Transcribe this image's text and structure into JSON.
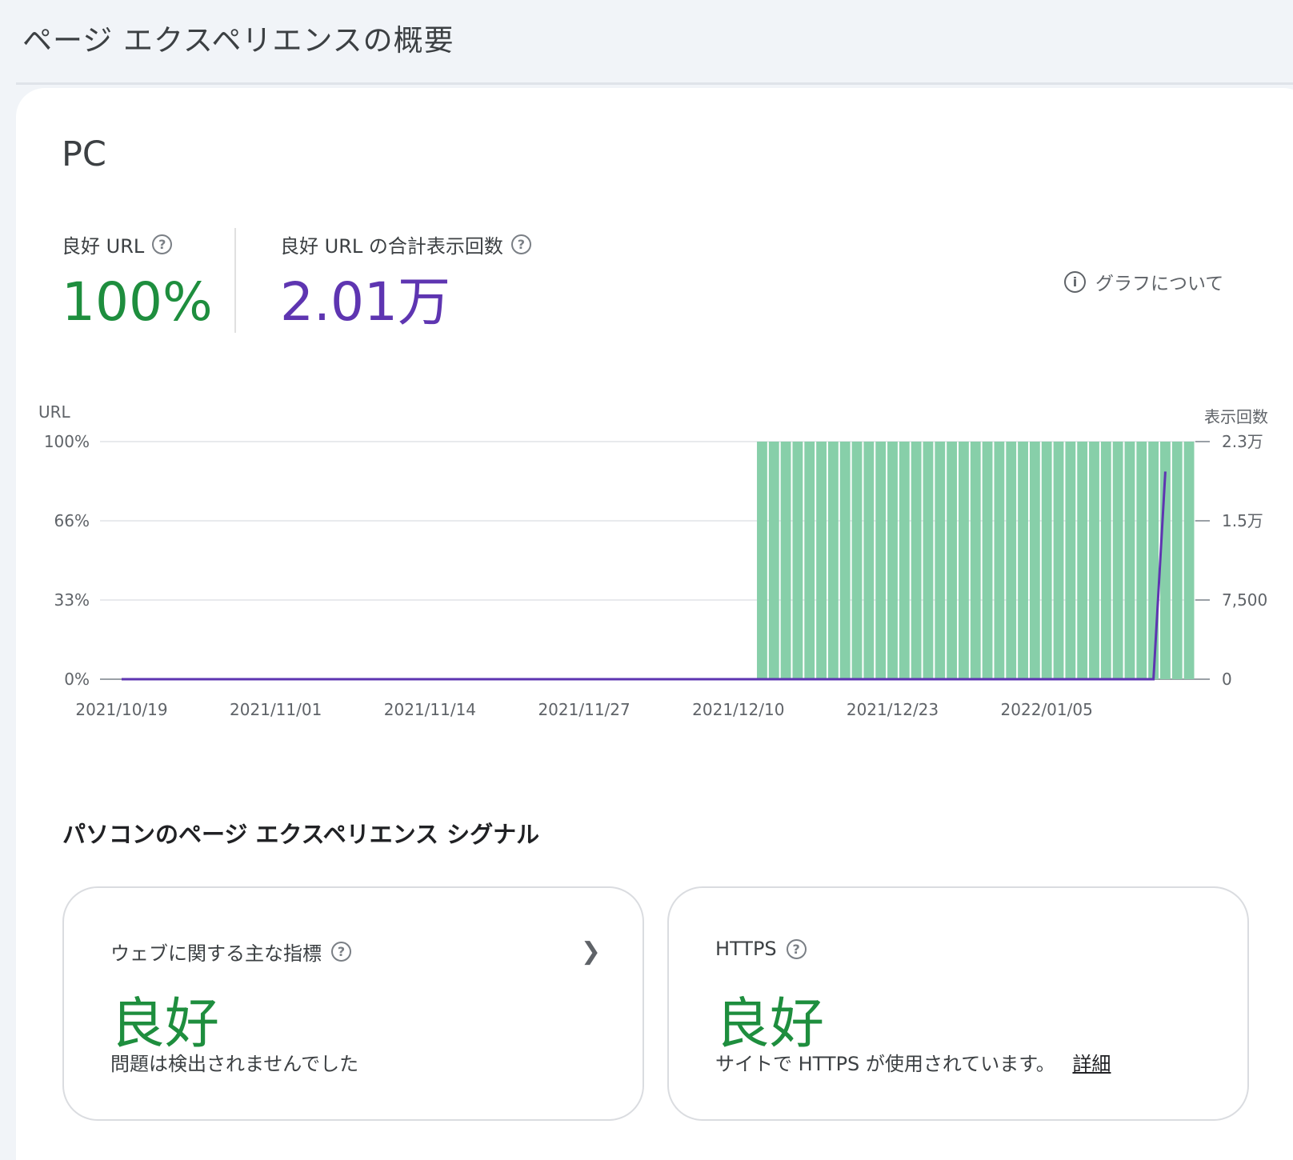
{
  "header": {
    "title": "ページ エクスペリエンスの概要"
  },
  "device": {
    "title": "PC"
  },
  "metrics": {
    "good_url": {
      "label": "良好 URL",
      "value": "100%"
    },
    "impressions": {
      "label": "良好 URL の合計表示回数",
      "value": "2.01万"
    }
  },
  "about_graph": {
    "label": "グラフについて"
  },
  "chart_data": {
    "type": "bar",
    "left_axis_title": "URL",
    "right_axis_title": "表示回数",
    "left_ticks": [
      "100%",
      "66%",
      "33%",
      "0%"
    ],
    "right_ticks": [
      "2.3万",
      "1.5万",
      "7,500",
      "0"
    ],
    "x_tick_labels": [
      "2021/10/19",
      "2021/11/01",
      "2021/11/14",
      "2021/11/27",
      "2021/12/10",
      "2021/12/23",
      "2022/01/05"
    ],
    "bars_start_date": "2021/12/12",
    "bars_end_date": "2022/01/17",
    "bar_value_percent": 100,
    "series": [
      {
        "name": "良好 URL",
        "color": "#87cfa9",
        "values_percent": [
          100
        ]
      },
      {
        "name": "表示回数",
        "color": "#5e35b1",
        "values": [
          0,
          0,
          20100
        ]
      }
    ]
  },
  "signals": {
    "section_title": "パソコンのページ エクスペリエンス シグナル",
    "cwv": {
      "label": "ウェブに関する主な指標",
      "status": "良好",
      "description": "問題は検出されませんでした"
    },
    "https": {
      "label": "HTTPS",
      "status": "良好",
      "description": "サイトで HTTPS が使用されています。",
      "link": "詳細"
    }
  }
}
